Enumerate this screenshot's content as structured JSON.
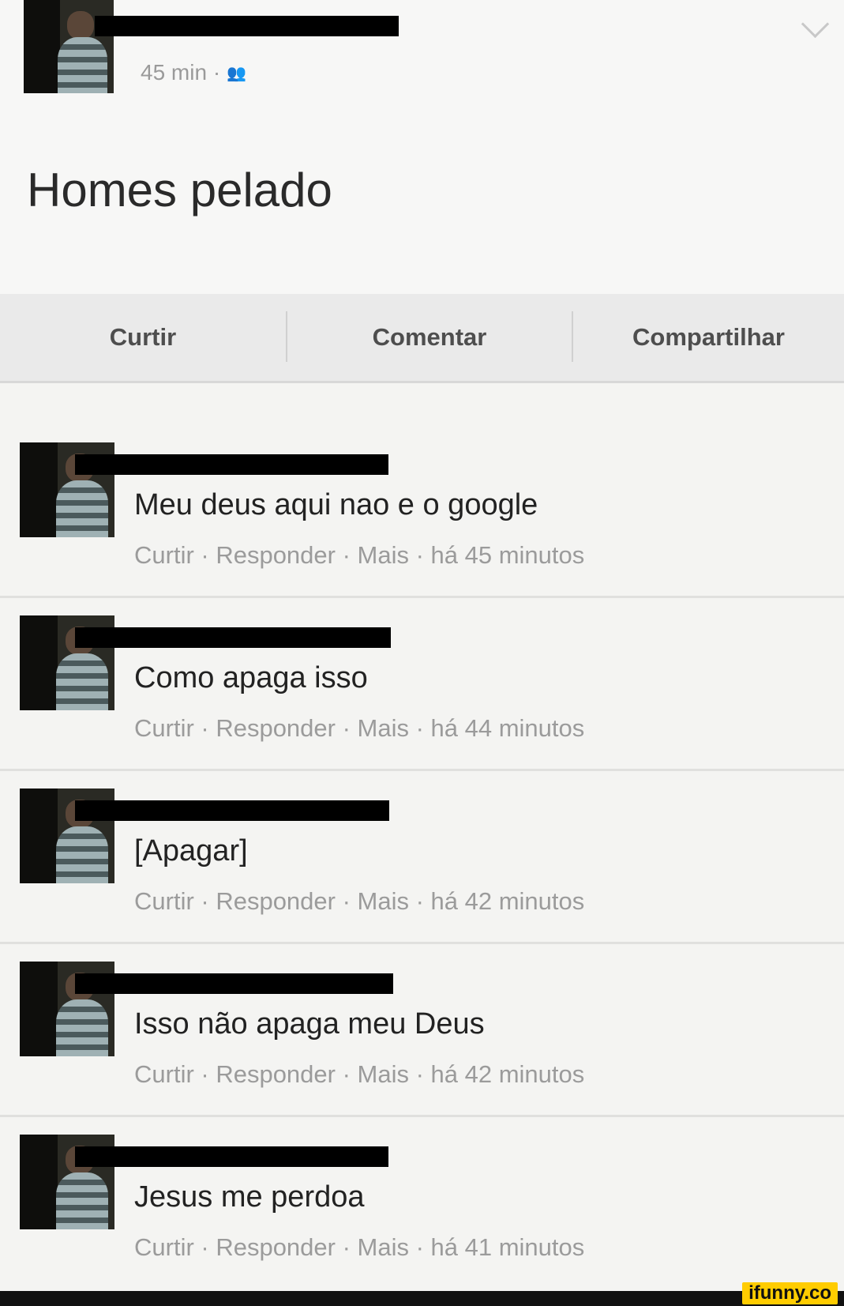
{
  "post": {
    "time": "45 min ·",
    "audience_icon": "friends-icon",
    "text": "Homes pelado"
  },
  "actions": {
    "like": "Curtir",
    "comment": "Comentar",
    "share": "Compartilhar"
  },
  "comments": [
    {
      "text": "Meu deus aqui nao e o google",
      "meta": "Curtir · Responder · Mais · há 45 minutos"
    },
    {
      "text": "Como apaga isso",
      "meta": "Curtir · Responder · Mais · há 44 minutos"
    },
    {
      "text": "[Apagar]",
      "meta": "Curtir · Responder · Mais · há 42 minutos"
    },
    {
      "text": "Isso não apaga meu Deus",
      "meta": "Curtir · Responder · Mais · há 42 minutos"
    },
    {
      "text": "Jesus me perdoa",
      "meta": "Curtir · Responder · Mais · há 41 minutos"
    }
  ],
  "watermark": "ifunny.co",
  "colors": {
    "redaction": "#000000",
    "watermark_bg": "#ffcc00"
  }
}
